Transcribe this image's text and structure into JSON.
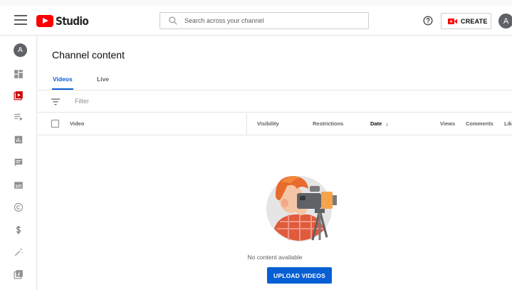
{
  "header": {
    "logo_text": "Studio",
    "search_placeholder": "Search across your channel",
    "create_label": "CREATE",
    "avatar_letter": "A"
  },
  "sidebar": {
    "avatar_letter": "A",
    "items": [
      {
        "icon": "dashboard-icon",
        "active": false
      },
      {
        "icon": "content-icon",
        "active": true
      },
      {
        "icon": "playlists-icon",
        "active": false
      },
      {
        "icon": "analytics-icon",
        "active": false
      },
      {
        "icon": "comments-icon",
        "active": false
      },
      {
        "icon": "subtitles-icon",
        "active": false
      },
      {
        "icon": "copyright-icon",
        "active": false
      },
      {
        "icon": "monetization-icon",
        "active": false
      },
      {
        "icon": "customization-icon",
        "active": false
      },
      {
        "icon": "audio-library-icon",
        "active": false
      }
    ]
  },
  "main": {
    "title": "Channel content",
    "tabs": [
      {
        "label": "Videos",
        "active": true
      },
      {
        "label": "Live",
        "active": false
      }
    ],
    "filter_placeholder": "Filter",
    "columns": {
      "video": "Video",
      "visibility": "Visibility",
      "restrictions": "Restrictions",
      "date": "Date",
      "sort_arrow": "↓",
      "views": "Views",
      "comments": "Comments",
      "likes": "Lik"
    },
    "empty_text": "No content available",
    "upload_label": "UPLOAD VIDEOS"
  },
  "colors": {
    "accent": "#065fd4",
    "brand": "#ff0000",
    "icon_gray": "#909090"
  }
}
